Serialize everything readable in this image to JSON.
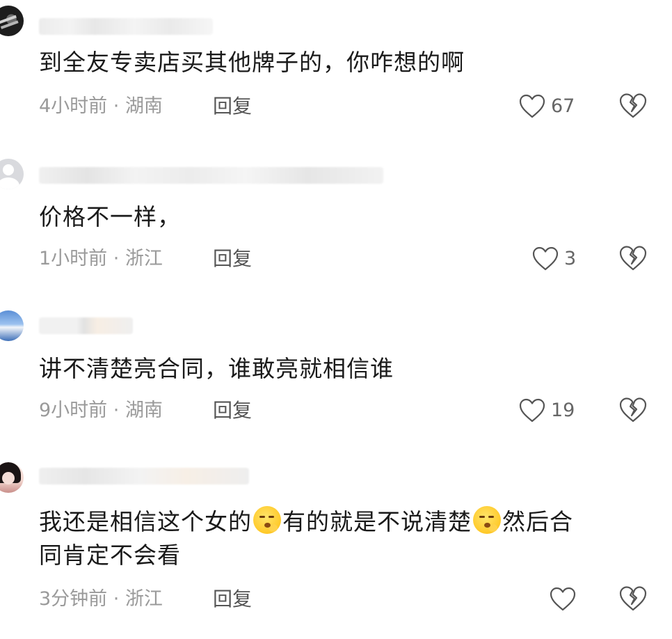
{
  "comments": [
    {
      "avatar": "dark-avatar",
      "text": "到全友专卖店买其他牌子的，你咋想的啊",
      "time": "4小时前",
      "location": "湖南",
      "reply_label": "回复",
      "likes": "67"
    },
    {
      "avatar": "default-avatar",
      "text": "价格不一样，",
      "time": "1小时前",
      "location": "浙江",
      "reply_label": "回复",
      "likes": "3"
    },
    {
      "avatar": "sky-avatar",
      "text": "讲不清楚亮合同，谁敢亮就相信谁",
      "time": "9小时前",
      "location": "湖南",
      "reply_label": "回复",
      "likes": "19"
    },
    {
      "avatar": "girl-avatar",
      "text_part1": "我还是相信这个女的",
      "text_part2": "有的就是不说清楚",
      "text_part3": "然后合",
      "text_line2": "同肯定不会看",
      "emoji": "shushing-face-emoji",
      "time": "3分钟前",
      "location": "浙江",
      "reply_label": "回复",
      "likes": ""
    }
  ],
  "meta_separator": " · ",
  "colors": {
    "background": "#ffffff",
    "text": "#1a1a1a",
    "meta": "#9a9a9a",
    "icon_stroke": "#555555"
  },
  "icons": {
    "like": "heart-outline-icon",
    "dislike": "broken-heart-icon"
  }
}
